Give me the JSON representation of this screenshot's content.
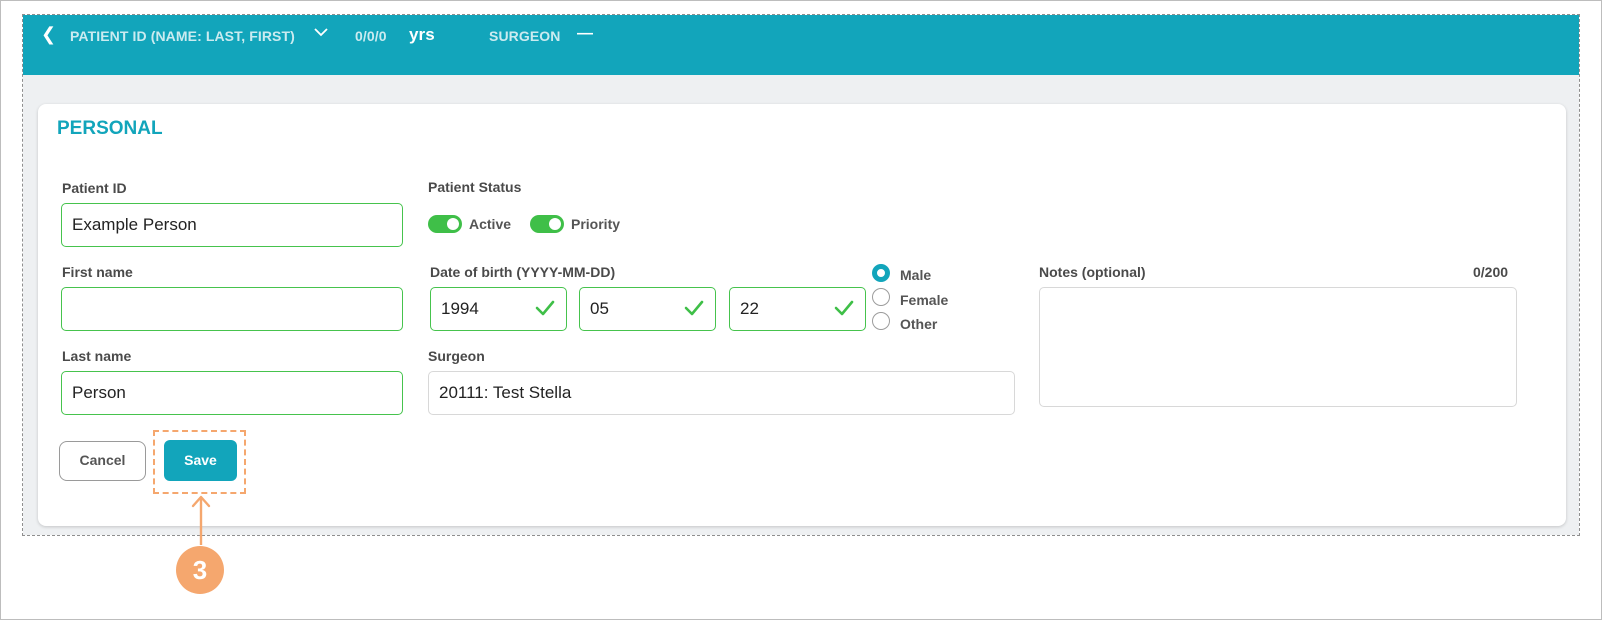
{
  "header": {
    "patient_id_label": "PATIENT ID (NAME: LAST, FIRST)",
    "age_value": "0/0/0",
    "age_unit": "yrs",
    "surgeon_label": "SURGEON",
    "surgeon_value": "—"
  },
  "section": {
    "title": "PERSONAL"
  },
  "form": {
    "patient_id": {
      "label": "Patient ID",
      "value": "Example Person"
    },
    "first_name": {
      "label": "First name",
      "value": ""
    },
    "last_name": {
      "label": "Last name",
      "value": "Person"
    },
    "patient_status": {
      "label": "Patient Status",
      "active_label": "Active",
      "active_on": true,
      "priority_label": "Priority",
      "priority_on": true
    },
    "dob": {
      "label": "Date of birth (YYYY-MM-DD)",
      "year": "1994",
      "month": "05",
      "day": "22"
    },
    "gender": {
      "options": [
        "Male",
        "Female",
        "Other"
      ],
      "selected": "Male"
    },
    "surgeon": {
      "label": "Surgeon",
      "value": "20111: Test Stella"
    },
    "notes": {
      "label": "Notes (optional)",
      "counter": "0/200",
      "value": ""
    }
  },
  "actions": {
    "cancel_label": "Cancel",
    "save_label": "Save"
  },
  "annotation": {
    "step_number": "3"
  },
  "colors": {
    "accent": "#12a5bb",
    "success": "#3fbf48",
    "callout": "#f5a76e"
  }
}
